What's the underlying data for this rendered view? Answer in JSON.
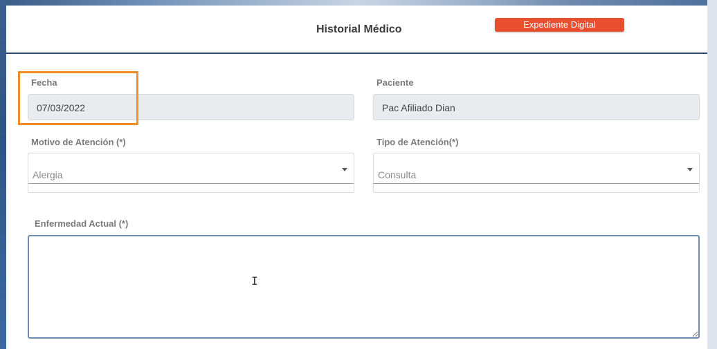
{
  "modal": {
    "title": "Historial Médico",
    "badge": "Expediente Digital"
  },
  "form": {
    "fecha": {
      "label": "Fecha",
      "value": "07/03/2022"
    },
    "paciente": {
      "label": "Paciente",
      "value": "Pac Afiliado Dian"
    },
    "motivo": {
      "label": "Motivo de Atención (*)",
      "value": "Alergia"
    },
    "tipo": {
      "label": "Tipo de Atención(*)",
      "value": "Consulta"
    },
    "enfermedad": {
      "label": "Enfermedad Actual (*)",
      "value": ""
    }
  },
  "colors": {
    "accent": "#e84f2f",
    "highlight": "#f28c28",
    "header_rule": "#2d4a6b"
  },
  "icons": {
    "select_caret": "chevron-down-icon",
    "text_cursor": "text-cursor-icon"
  }
}
